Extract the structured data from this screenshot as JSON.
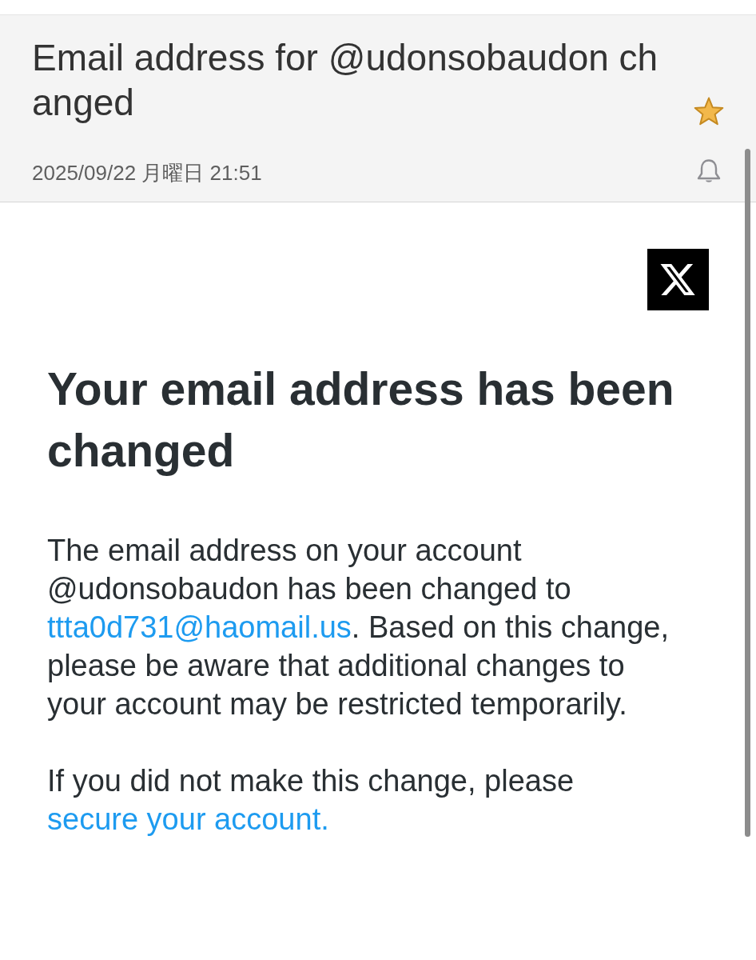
{
  "email": {
    "subject": "Email address for @udonsobaudon changed",
    "starred": true,
    "date": "2025/09/22 月曜日 21:51"
  },
  "message": {
    "headline": "Your email address has been changed",
    "paragraphs": [
      {
        "parts": [
          {
            "kind": "text",
            "text": "The email address on your account @udonsobaudon has been changed to "
          },
          {
            "kind": "link",
            "text": "ttta0d731@haomail.us"
          },
          {
            "kind": "text",
            "text": ". Based on this change, please be aware that additional changes to your account may be restricted temporarily."
          }
        ]
      },
      {
        "parts": [
          {
            "kind": "text",
            "text": "If you did not make this change, please "
          },
          {
            "kind": "link",
            "text": "secure your account."
          }
        ]
      }
    ]
  }
}
